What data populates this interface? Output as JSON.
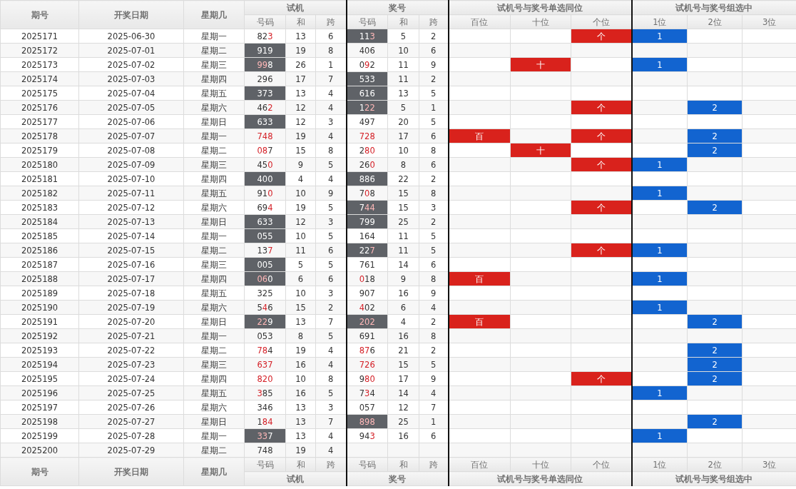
{
  "header": {
    "fixed": [
      "期号",
      "开奖日期",
      "星期几"
    ],
    "groups": [
      {
        "title": "试机",
        "subs": [
          "号码",
          "和",
          "跨"
        ]
      },
      {
        "title": "奖号",
        "subs": [
          "号码",
          "和",
          "跨"
        ]
      },
      {
        "title": "试机号与奖号单选同位",
        "subs": [
          "百位",
          "十位",
          "个位"
        ]
      },
      {
        "title": "试机号与奖号组选中",
        "subs": [
          "1位",
          "2位",
          "3位"
        ]
      }
    ]
  },
  "rows": [
    {
      "issue": "2025171",
      "date": "2025-06-30",
      "weekday": "星期一",
      "trial": {
        "code": "823",
        "hits": [
          false,
          false,
          true
        ],
        "shaded": false,
        "sum": "13",
        "span": "6"
      },
      "draw": {
        "code": "113",
        "hits": [
          false,
          false,
          true
        ],
        "shaded": true,
        "sum": "5",
        "span": "2"
      },
      "pos": [
        {
          "hit": false
        },
        {
          "hit": false
        },
        {
          "hit": true,
          "text": "个"
        }
      ],
      "group": [
        {
          "hit": true,
          "text": "1"
        },
        {
          "hit": false
        },
        {
          "hit": false
        }
      ]
    },
    {
      "issue": "2025172",
      "date": "2025-07-01",
      "weekday": "星期二",
      "trial": {
        "code": "919",
        "hits": [
          false,
          false,
          false
        ],
        "shaded": true,
        "sum": "19",
        "span": "8"
      },
      "draw": {
        "code": "406",
        "hits": [
          false,
          false,
          false
        ],
        "shaded": false,
        "sum": "10",
        "span": "6"
      },
      "pos": [
        {
          "hit": false
        },
        {
          "hit": false
        },
        {
          "hit": false
        }
      ],
      "group": [
        {
          "hit": false
        },
        {
          "hit": false
        },
        {
          "hit": false
        }
      ]
    },
    {
      "issue": "2025173",
      "date": "2025-07-02",
      "weekday": "星期三",
      "trial": {
        "code": "998",
        "hits": [
          true,
          true,
          false
        ],
        "shaded": true,
        "sum": "26",
        "span": "1"
      },
      "draw": {
        "code": "092",
        "hits": [
          false,
          true,
          false
        ],
        "shaded": false,
        "sum": "11",
        "span": "9"
      },
      "pos": [
        {
          "hit": false
        },
        {
          "hit": true,
          "text": "十"
        },
        {
          "hit": false
        }
      ],
      "group": [
        {
          "hit": true,
          "text": "1"
        },
        {
          "hit": false
        },
        {
          "hit": false
        }
      ]
    },
    {
      "issue": "2025174",
      "date": "2025-07-03",
      "weekday": "星期四",
      "trial": {
        "code": "296",
        "hits": [
          false,
          false,
          false
        ],
        "shaded": false,
        "sum": "17",
        "span": "7"
      },
      "draw": {
        "code": "533",
        "hits": [
          false,
          false,
          false
        ],
        "shaded": true,
        "sum": "11",
        "span": "2"
      },
      "pos": [
        {
          "hit": false
        },
        {
          "hit": false
        },
        {
          "hit": false
        }
      ],
      "group": [
        {
          "hit": false
        },
        {
          "hit": false
        },
        {
          "hit": false
        }
      ]
    },
    {
      "issue": "2025175",
      "date": "2025-07-04",
      "weekday": "星期五",
      "trial": {
        "code": "373",
        "hits": [
          false,
          false,
          false
        ],
        "shaded": true,
        "sum": "13",
        "span": "4"
      },
      "draw": {
        "code": "616",
        "hits": [
          false,
          false,
          false
        ],
        "shaded": true,
        "sum": "13",
        "span": "5"
      },
      "pos": [
        {
          "hit": false
        },
        {
          "hit": false
        },
        {
          "hit": false
        }
      ],
      "group": [
        {
          "hit": false
        },
        {
          "hit": false
        },
        {
          "hit": false
        }
      ]
    },
    {
      "issue": "2025176",
      "date": "2025-07-05",
      "weekday": "星期六",
      "trial": {
        "code": "462",
        "hits": [
          false,
          false,
          true
        ],
        "shaded": false,
        "sum": "12",
        "span": "4"
      },
      "draw": {
        "code": "122",
        "hits": [
          false,
          true,
          true
        ],
        "shaded": true,
        "sum": "5",
        "span": "1"
      },
      "pos": [
        {
          "hit": false
        },
        {
          "hit": false
        },
        {
          "hit": true,
          "text": "个"
        }
      ],
      "group": [
        {
          "hit": false
        },
        {
          "hit": true,
          "text": "2"
        },
        {
          "hit": false
        }
      ]
    },
    {
      "issue": "2025177",
      "date": "2025-07-06",
      "weekday": "星期日",
      "trial": {
        "code": "633",
        "hits": [
          false,
          false,
          false
        ],
        "shaded": true,
        "sum": "12",
        "span": "3"
      },
      "draw": {
        "code": "497",
        "hits": [
          false,
          false,
          false
        ],
        "shaded": false,
        "sum": "20",
        "span": "5"
      },
      "pos": [
        {
          "hit": false
        },
        {
          "hit": false
        },
        {
          "hit": false
        }
      ],
      "group": [
        {
          "hit": false
        },
        {
          "hit": false
        },
        {
          "hit": false
        }
      ]
    },
    {
      "issue": "2025178",
      "date": "2025-07-07",
      "weekday": "星期一",
      "trial": {
        "code": "748",
        "hits": [
          true,
          true,
          true
        ],
        "shaded": false,
        "sum": "19",
        "span": "4"
      },
      "draw": {
        "code": "728",
        "hits": [
          true,
          true,
          true
        ],
        "shaded": false,
        "sum": "17",
        "span": "6"
      },
      "pos": [
        {
          "hit": true,
          "text": "百"
        },
        {
          "hit": false
        },
        {
          "hit": true,
          "text": "个"
        }
      ],
      "group": [
        {
          "hit": false
        },
        {
          "hit": true,
          "text": "2"
        },
        {
          "hit": false
        }
      ]
    },
    {
      "issue": "2025179",
      "date": "2025-07-08",
      "weekday": "星期二",
      "trial": {
        "code": "087",
        "hits": [
          true,
          true,
          false
        ],
        "shaded": false,
        "sum": "15",
        "span": "8"
      },
      "draw": {
        "code": "280",
        "hits": [
          false,
          true,
          true
        ],
        "shaded": false,
        "sum": "10",
        "span": "8"
      },
      "pos": [
        {
          "hit": false
        },
        {
          "hit": true,
          "text": "十"
        },
        {
          "hit": false
        }
      ],
      "group": [
        {
          "hit": false
        },
        {
          "hit": true,
          "text": "2"
        },
        {
          "hit": false
        }
      ]
    },
    {
      "issue": "2025180",
      "date": "2025-07-09",
      "weekday": "星期三",
      "trial": {
        "code": "450",
        "hits": [
          false,
          false,
          true
        ],
        "shaded": false,
        "sum": "9",
        "span": "5"
      },
      "draw": {
        "code": "260",
        "hits": [
          false,
          false,
          true
        ],
        "shaded": false,
        "sum": "8",
        "span": "6"
      },
      "pos": [
        {
          "hit": false
        },
        {
          "hit": false
        },
        {
          "hit": true,
          "text": "个"
        }
      ],
      "group": [
        {
          "hit": true,
          "text": "1"
        },
        {
          "hit": false
        },
        {
          "hit": false
        }
      ]
    },
    {
      "issue": "2025181",
      "date": "2025-07-10",
      "weekday": "星期四",
      "trial": {
        "code": "400",
        "hits": [
          false,
          false,
          false
        ],
        "shaded": true,
        "sum": "4",
        "span": "4"
      },
      "draw": {
        "code": "886",
        "hits": [
          false,
          false,
          false
        ],
        "shaded": true,
        "sum": "22",
        "span": "2"
      },
      "pos": [
        {
          "hit": false
        },
        {
          "hit": false
        },
        {
          "hit": false
        }
      ],
      "group": [
        {
          "hit": false
        },
        {
          "hit": false
        },
        {
          "hit": false
        }
      ]
    },
    {
      "issue": "2025182",
      "date": "2025-07-11",
      "weekday": "星期五",
      "trial": {
        "code": "910",
        "hits": [
          false,
          false,
          true
        ],
        "shaded": false,
        "sum": "10",
        "span": "9"
      },
      "draw": {
        "code": "708",
        "hits": [
          false,
          true,
          false
        ],
        "shaded": false,
        "sum": "15",
        "span": "8"
      },
      "pos": [
        {
          "hit": false
        },
        {
          "hit": false
        },
        {
          "hit": false
        }
      ],
      "group": [
        {
          "hit": true,
          "text": "1"
        },
        {
          "hit": false
        },
        {
          "hit": false
        }
      ]
    },
    {
      "issue": "2025183",
      "date": "2025-07-12",
      "weekday": "星期六",
      "trial": {
        "code": "694",
        "hits": [
          false,
          false,
          true
        ],
        "shaded": false,
        "sum": "19",
        "span": "5"
      },
      "draw": {
        "code": "744",
        "hits": [
          false,
          true,
          true
        ],
        "shaded": true,
        "sum": "15",
        "span": "3"
      },
      "pos": [
        {
          "hit": false
        },
        {
          "hit": false
        },
        {
          "hit": true,
          "text": "个"
        }
      ],
      "group": [
        {
          "hit": false
        },
        {
          "hit": true,
          "text": "2"
        },
        {
          "hit": false
        }
      ]
    },
    {
      "issue": "2025184",
      "date": "2025-07-13",
      "weekday": "星期日",
      "trial": {
        "code": "633",
        "hits": [
          false,
          false,
          false
        ],
        "shaded": true,
        "sum": "12",
        "span": "3"
      },
      "draw": {
        "code": "799",
        "hits": [
          false,
          false,
          false
        ],
        "shaded": true,
        "sum": "25",
        "span": "2"
      },
      "pos": [
        {
          "hit": false
        },
        {
          "hit": false
        },
        {
          "hit": false
        }
      ],
      "group": [
        {
          "hit": false
        },
        {
          "hit": false
        },
        {
          "hit": false
        }
      ]
    },
    {
      "issue": "2025185",
      "date": "2025-07-14",
      "weekday": "星期一",
      "trial": {
        "code": "055",
        "hits": [
          false,
          false,
          false
        ],
        "shaded": true,
        "sum": "10",
        "span": "5"
      },
      "draw": {
        "code": "164",
        "hits": [
          false,
          false,
          false
        ],
        "shaded": false,
        "sum": "11",
        "span": "5"
      },
      "pos": [
        {
          "hit": false
        },
        {
          "hit": false
        },
        {
          "hit": false
        }
      ],
      "group": [
        {
          "hit": false
        },
        {
          "hit": false
        },
        {
          "hit": false
        }
      ]
    },
    {
      "issue": "2025186",
      "date": "2025-07-15",
      "weekday": "星期二",
      "trial": {
        "code": "137",
        "hits": [
          false,
          false,
          true
        ],
        "shaded": false,
        "sum": "11",
        "span": "6"
      },
      "draw": {
        "code": "227",
        "hits": [
          false,
          false,
          true
        ],
        "shaded": true,
        "sum": "11",
        "span": "5"
      },
      "pos": [
        {
          "hit": false
        },
        {
          "hit": false
        },
        {
          "hit": true,
          "text": "个"
        }
      ],
      "group": [
        {
          "hit": true,
          "text": "1"
        },
        {
          "hit": false
        },
        {
          "hit": false
        }
      ]
    },
    {
      "issue": "2025187",
      "date": "2025-07-16",
      "weekday": "星期三",
      "trial": {
        "code": "005",
        "hits": [
          false,
          false,
          false
        ],
        "shaded": true,
        "sum": "5",
        "span": "5"
      },
      "draw": {
        "code": "761",
        "hits": [
          false,
          false,
          false
        ],
        "shaded": false,
        "sum": "14",
        "span": "6"
      },
      "pos": [
        {
          "hit": false
        },
        {
          "hit": false
        },
        {
          "hit": false
        }
      ],
      "group": [
        {
          "hit": false
        },
        {
          "hit": false
        },
        {
          "hit": false
        }
      ]
    },
    {
      "issue": "2025188",
      "date": "2025-07-17",
      "weekday": "星期四",
      "trial": {
        "code": "060",
        "hits": [
          true,
          true,
          false
        ],
        "shaded": true,
        "sum": "6",
        "span": "6"
      },
      "draw": {
        "code": "018",
        "hits": [
          true,
          false,
          false
        ],
        "shaded": false,
        "sum": "9",
        "span": "8"
      },
      "pos": [
        {
          "hit": true,
          "text": "百"
        },
        {
          "hit": false
        },
        {
          "hit": false
        }
      ],
      "group": [
        {
          "hit": true,
          "text": "1"
        },
        {
          "hit": false
        },
        {
          "hit": false
        }
      ]
    },
    {
      "issue": "2025189",
      "date": "2025-07-18",
      "weekday": "星期五",
      "trial": {
        "code": "325",
        "hits": [
          false,
          false,
          false
        ],
        "shaded": false,
        "sum": "10",
        "span": "3"
      },
      "draw": {
        "code": "907",
        "hits": [
          false,
          false,
          false
        ],
        "shaded": false,
        "sum": "16",
        "span": "9"
      },
      "pos": [
        {
          "hit": false
        },
        {
          "hit": false
        },
        {
          "hit": false
        }
      ],
      "group": [
        {
          "hit": false
        },
        {
          "hit": false
        },
        {
          "hit": false
        }
      ]
    },
    {
      "issue": "2025190",
      "date": "2025-07-19",
      "weekday": "星期六",
      "trial": {
        "code": "546",
        "hits": [
          false,
          true,
          false
        ],
        "shaded": false,
        "sum": "15",
        "span": "2"
      },
      "draw": {
        "code": "402",
        "hits": [
          true,
          false,
          false
        ],
        "shaded": false,
        "sum": "6",
        "span": "4"
      },
      "pos": [
        {
          "hit": false
        },
        {
          "hit": false
        },
        {
          "hit": false
        }
      ],
      "group": [
        {
          "hit": true,
          "text": "1"
        },
        {
          "hit": false
        },
        {
          "hit": false
        }
      ]
    },
    {
      "issue": "2025191",
      "date": "2025-07-20",
      "weekday": "星期日",
      "trial": {
        "code": "229",
        "hits": [
          true,
          true,
          false
        ],
        "shaded": true,
        "sum": "13",
        "span": "7"
      },
      "draw": {
        "code": "202",
        "hits": [
          true,
          true,
          true
        ],
        "shaded": true,
        "sum": "4",
        "span": "2"
      },
      "pos": [
        {
          "hit": true,
          "text": "百"
        },
        {
          "hit": false
        },
        {
          "hit": false
        }
      ],
      "group": [
        {
          "hit": false
        },
        {
          "hit": true,
          "text": "2"
        },
        {
          "hit": false
        }
      ]
    },
    {
      "issue": "2025192",
      "date": "2025-07-21",
      "weekday": "星期一",
      "trial": {
        "code": "053",
        "hits": [
          false,
          false,
          false
        ],
        "shaded": false,
        "sum": "8",
        "span": "5"
      },
      "draw": {
        "code": "691",
        "hits": [
          false,
          false,
          false
        ],
        "shaded": false,
        "sum": "16",
        "span": "8"
      },
      "pos": [
        {
          "hit": false
        },
        {
          "hit": false
        },
        {
          "hit": false
        }
      ],
      "group": [
        {
          "hit": false
        },
        {
          "hit": false
        },
        {
          "hit": false
        }
      ]
    },
    {
      "issue": "2025193",
      "date": "2025-07-22",
      "weekday": "星期二",
      "trial": {
        "code": "784",
        "hits": [
          true,
          true,
          false
        ],
        "shaded": false,
        "sum": "19",
        "span": "4"
      },
      "draw": {
        "code": "876",
        "hits": [
          true,
          true,
          false
        ],
        "shaded": false,
        "sum": "21",
        "span": "2"
      },
      "pos": [
        {
          "hit": false
        },
        {
          "hit": false
        },
        {
          "hit": false
        }
      ],
      "group": [
        {
          "hit": false
        },
        {
          "hit": true,
          "text": "2"
        },
        {
          "hit": false
        }
      ]
    },
    {
      "issue": "2025194",
      "date": "2025-07-23",
      "weekday": "星期三",
      "trial": {
        "code": "637",
        "hits": [
          true,
          true,
          true
        ],
        "shaded": false,
        "sum": "16",
        "span": "4"
      },
      "draw": {
        "code": "726",
        "hits": [
          true,
          true,
          true
        ],
        "shaded": false,
        "sum": "15",
        "span": "5"
      },
      "pos": [
        {
          "hit": false
        },
        {
          "hit": false
        },
        {
          "hit": false
        }
      ],
      "group": [
        {
          "hit": false
        },
        {
          "hit": true,
          "text": "2"
        },
        {
          "hit": false
        }
      ]
    },
    {
      "issue": "2025195",
      "date": "2025-07-24",
      "weekday": "星期四",
      "trial": {
        "code": "820",
        "hits": [
          true,
          true,
          true
        ],
        "shaded": false,
        "sum": "10",
        "span": "8"
      },
      "draw": {
        "code": "980",
        "hits": [
          false,
          true,
          true
        ],
        "shaded": false,
        "sum": "17",
        "span": "9"
      },
      "pos": [
        {
          "hit": false
        },
        {
          "hit": false
        },
        {
          "hit": true,
          "text": "个"
        }
      ],
      "group": [
        {
          "hit": false
        },
        {
          "hit": true,
          "text": "2"
        },
        {
          "hit": false
        }
      ]
    },
    {
      "issue": "2025196",
      "date": "2025-07-25",
      "weekday": "星期五",
      "trial": {
        "code": "385",
        "hits": [
          true,
          false,
          false
        ],
        "shaded": false,
        "sum": "16",
        "span": "5"
      },
      "draw": {
        "code": "734",
        "hits": [
          false,
          true,
          false
        ],
        "shaded": false,
        "sum": "14",
        "span": "4"
      },
      "pos": [
        {
          "hit": false
        },
        {
          "hit": false
        },
        {
          "hit": false
        }
      ],
      "group": [
        {
          "hit": true,
          "text": "1"
        },
        {
          "hit": false
        },
        {
          "hit": false
        }
      ]
    },
    {
      "issue": "2025197",
      "date": "2025-07-26",
      "weekday": "星期六",
      "trial": {
        "code": "346",
        "hits": [
          false,
          false,
          false
        ],
        "shaded": false,
        "sum": "13",
        "span": "3"
      },
      "draw": {
        "code": "057",
        "hits": [
          false,
          false,
          false
        ],
        "shaded": false,
        "sum": "12",
        "span": "7"
      },
      "pos": [
        {
          "hit": false
        },
        {
          "hit": false
        },
        {
          "hit": false
        }
      ],
      "group": [
        {
          "hit": false
        },
        {
          "hit": false
        },
        {
          "hit": false
        }
      ]
    },
    {
      "issue": "2025198",
      "date": "2025-07-27",
      "weekday": "星期日",
      "trial": {
        "code": "184",
        "hits": [
          false,
          true,
          true
        ],
        "shaded": false,
        "sum": "13",
        "span": "7"
      },
      "draw": {
        "code": "898",
        "hits": [
          true,
          true,
          true
        ],
        "shaded": true,
        "sum": "25",
        "span": "1"
      },
      "pos": [
        {
          "hit": false
        },
        {
          "hit": false
        },
        {
          "hit": false
        }
      ],
      "group": [
        {
          "hit": false
        },
        {
          "hit": true,
          "text": "2"
        },
        {
          "hit": false
        }
      ]
    },
    {
      "issue": "2025199",
      "date": "2025-07-28",
      "weekday": "星期一",
      "trial": {
        "code": "337",
        "hits": [
          true,
          true,
          false
        ],
        "shaded": true,
        "sum": "13",
        "span": "4"
      },
      "draw": {
        "code": "943",
        "hits": [
          false,
          false,
          true
        ],
        "shaded": false,
        "sum": "16",
        "span": "6"
      },
      "pos": [
        {
          "hit": false
        },
        {
          "hit": false
        },
        {
          "hit": false
        }
      ],
      "group": [
        {
          "hit": true,
          "text": "1"
        },
        {
          "hit": false
        },
        {
          "hit": false
        }
      ]
    },
    {
      "issue": "2025200",
      "date": "2025-07-29",
      "weekday": "星期二",
      "trial": {
        "code": "748",
        "hits": [
          false,
          false,
          false
        ],
        "shaded": false,
        "sum": "19",
        "span": "4"
      }
    }
  ],
  "footer": {
    "fixed": [
      "期号",
      "开奖日期",
      "星期几"
    ],
    "groups": [
      {
        "title": "试机",
        "subs": [
          "号码",
          "和",
          "跨"
        ]
      },
      {
        "title": "奖号",
        "subs": [
          "号码",
          "和",
          "跨"
        ]
      },
      {
        "title": "试机号与奖号单选同位",
        "subs": [
          "百位",
          "十位",
          "个位"
        ]
      },
      {
        "title": "试机号与奖号组选中",
        "subs": [
          "1位",
          "2位",
          "3位"
        ]
      }
    ]
  }
}
